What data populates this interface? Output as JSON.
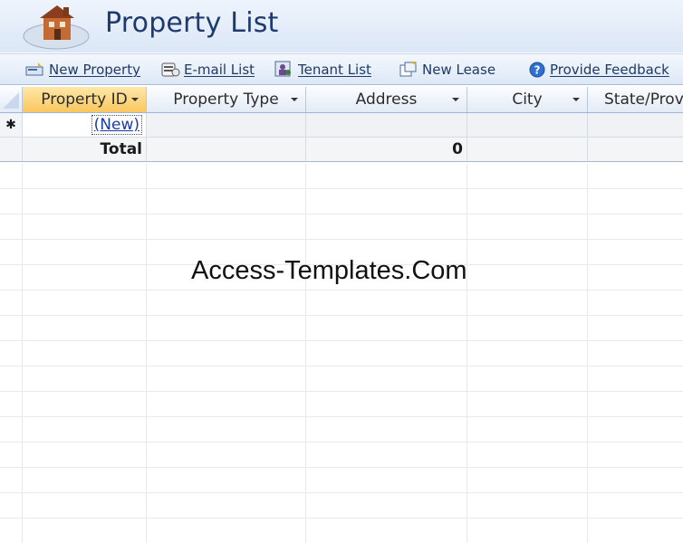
{
  "header": {
    "title": "Property List",
    "logo_icon": "house-icon"
  },
  "toolbar": {
    "items": [
      {
        "label": "New Property",
        "icon": "new-property-icon"
      },
      {
        "label": "E-mail List",
        "icon": "email-icon"
      },
      {
        "label": "Tenant List",
        "icon": "tenant-icon"
      },
      {
        "label": "New Lease",
        "icon": "new-lease-icon"
      },
      {
        "label": "Provide Feedback",
        "icon": "help-icon"
      }
    ]
  },
  "datasheet": {
    "columns": [
      "Property ID",
      "Property Type",
      "Address",
      "City",
      "State/Prov"
    ],
    "new_row": {
      "selector_symbol": "✱",
      "property_id": "(New)"
    },
    "total_row": {
      "label": "Total",
      "address_value": "0"
    }
  },
  "watermark": "Access-Templates.Com",
  "colors": {
    "title": "#1d3b6f",
    "selected_column": "#f9c75f",
    "link": "#1a3aa8"
  }
}
